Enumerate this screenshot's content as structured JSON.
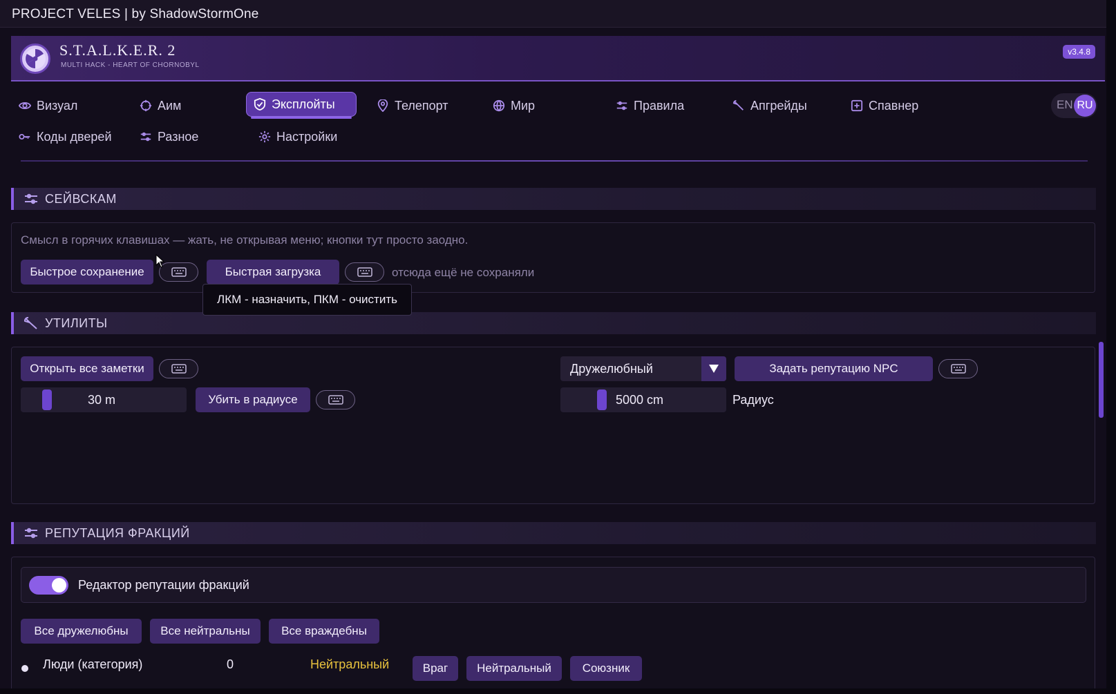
{
  "window": {
    "title": "PROJECT VELES  |  by ShadowStormOne"
  },
  "header": {
    "title": "S.T.A.L.K.E.R. 2",
    "subtitle": "MULTI HACK  -  HEART OF CHORNOBYL",
    "version": "v3.4.8"
  },
  "tabs": [
    {
      "label": "Визуал",
      "icon": "eye-icon"
    },
    {
      "label": "Аим",
      "icon": "crosshair-icon"
    },
    {
      "label": "Эксплойты",
      "icon": "shield-icon",
      "active": true
    },
    {
      "label": "Телепорт",
      "icon": "map-pin-icon"
    },
    {
      "label": "Мир",
      "icon": "globe-icon"
    },
    {
      "label": "Правила",
      "icon": "sliders-icon"
    },
    {
      "label": "Апгрейды",
      "icon": "wrench-icon"
    },
    {
      "label": "Спавнер",
      "icon": "plus-square-icon"
    },
    {
      "label": "Коды дверей",
      "icon": "key-icon"
    },
    {
      "label": "Разное",
      "icon": "sliders-icon"
    },
    {
      "label": "Настройки",
      "icon": "gear-icon"
    }
  ],
  "lang": {
    "en": "EN",
    "ru": "RU",
    "selected": "RU"
  },
  "savescum": {
    "title": "СЕЙВСКАМ",
    "description": "Смысл в горячих клавишах — жать, не открывая меню; кнопки тут просто заодно.",
    "quick_save": "Быстрое сохранение",
    "quick_load": "Быстрая загрузка",
    "status": "отсюда ещё не сохраняли",
    "tooltip": "ЛКМ - назначить, ПКМ - очистить"
  },
  "utilities": {
    "title": "УТИЛИТЫ",
    "open_notes": "Открыть все заметки",
    "kill_radius_value": "30 m",
    "kill_radius_button": "Убить в радиусе",
    "reputation_select": "Дружелюбный",
    "set_npc_reputation": "Задать репутацию NPC",
    "radius_value": "5000 cm",
    "radius_label": "Радиус"
  },
  "factions": {
    "title": "РЕПУТАЦИЯ ФРАКЦИЙ",
    "editor_toggle_label": "Редактор репутации фракций",
    "editor_enabled": true,
    "all_friendly": "Все дружелюбны",
    "all_neutral": "Все нейтральны",
    "all_hostile": "Все враждебны",
    "rows": [
      {
        "name": "Люди (категория)",
        "value": "0",
        "status": "Нейтральный",
        "btn_enemy": "Враг",
        "btn_neutral": "Нейтральный",
        "btn_ally": "Союзник"
      }
    ]
  },
  "colors": {
    "accent": "#8a5de6",
    "button": "#3f2a6b",
    "neutral_status": "#e8c23d"
  }
}
